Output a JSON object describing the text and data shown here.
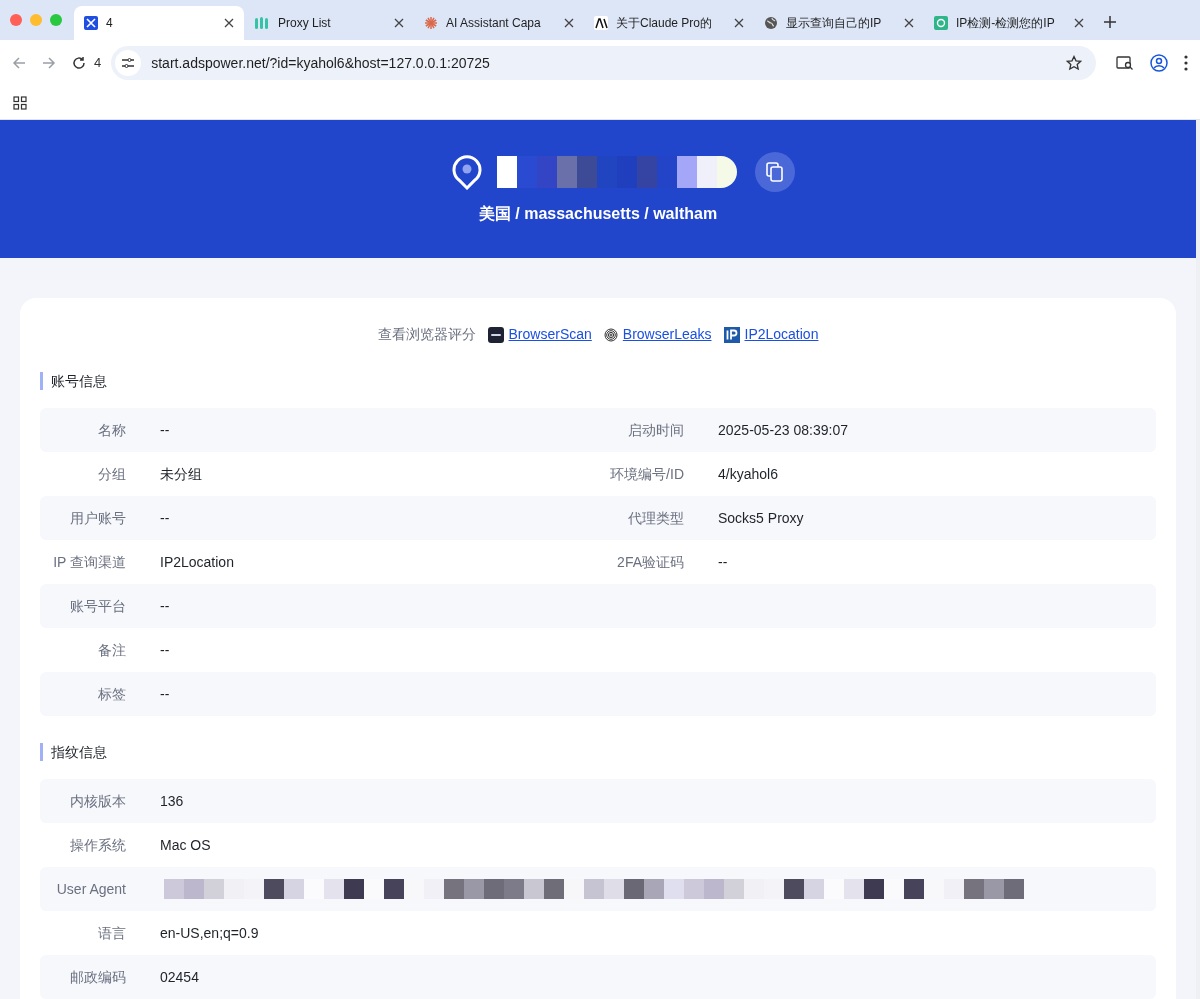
{
  "tabs": [
    {
      "title": "4",
      "selected": true
    },
    {
      "title": "Proxy List",
      "selected": false
    },
    {
      "title": "AI Assistant Capa",
      "selected": false
    },
    {
      "title": "关于Claude Pro的",
      "selected": false
    },
    {
      "title": "显示查询自己的IP",
      "selected": false
    },
    {
      "title": "IP检测-检测您的IP",
      "selected": false
    }
  ],
  "toolbar": {
    "tab_count": "4",
    "url": "start.adspower.net/?id=kyahol6&host=127.0.0.1:20725"
  },
  "banner": {
    "location": "美国 / massachusetts / waltham"
  },
  "score_links": {
    "label": "查看浏览器评分",
    "links": [
      {
        "text": "BrowserScan"
      },
      {
        "text": "BrowserLeaks"
      },
      {
        "text": "IP2Location"
      }
    ]
  },
  "sections": [
    {
      "title": "账号信息",
      "rows": [
        [
          {
            "label": "名称",
            "value": "--"
          },
          {
            "label": "启动时间",
            "value": "2025-05-23 08:39:07"
          }
        ],
        [
          {
            "label": "分组",
            "value": "未分组"
          },
          {
            "label": "环境编号/ID",
            "value": "4/kyahol6"
          }
        ],
        [
          {
            "label": "用户账号",
            "value": "--"
          },
          {
            "label": "代理类型",
            "value": "Socks5 Proxy"
          }
        ],
        [
          {
            "label": "IP 查询渠道",
            "value": "IP2Location"
          },
          {
            "label": "2FA验证码",
            "value": "--"
          }
        ],
        [
          {
            "label": "账号平台",
            "value": "--"
          }
        ],
        [
          {
            "label": "备注",
            "value": "--"
          }
        ],
        [
          {
            "label": "标签",
            "value": "--"
          }
        ]
      ]
    },
    {
      "title": "指纹信息",
      "rows": [
        [
          {
            "label": "内核版本",
            "value": "136"
          }
        ],
        [
          {
            "label": "操作系统",
            "value": "Mac OS"
          }
        ],
        [
          {
            "label": "User Agent",
            "kind": "redacted"
          }
        ],
        [
          {
            "label": "语言",
            "value": "en-US,en;q=0.9"
          }
        ],
        [
          {
            "label": "邮政编码",
            "value": "02454"
          }
        ]
      ]
    }
  ]
}
